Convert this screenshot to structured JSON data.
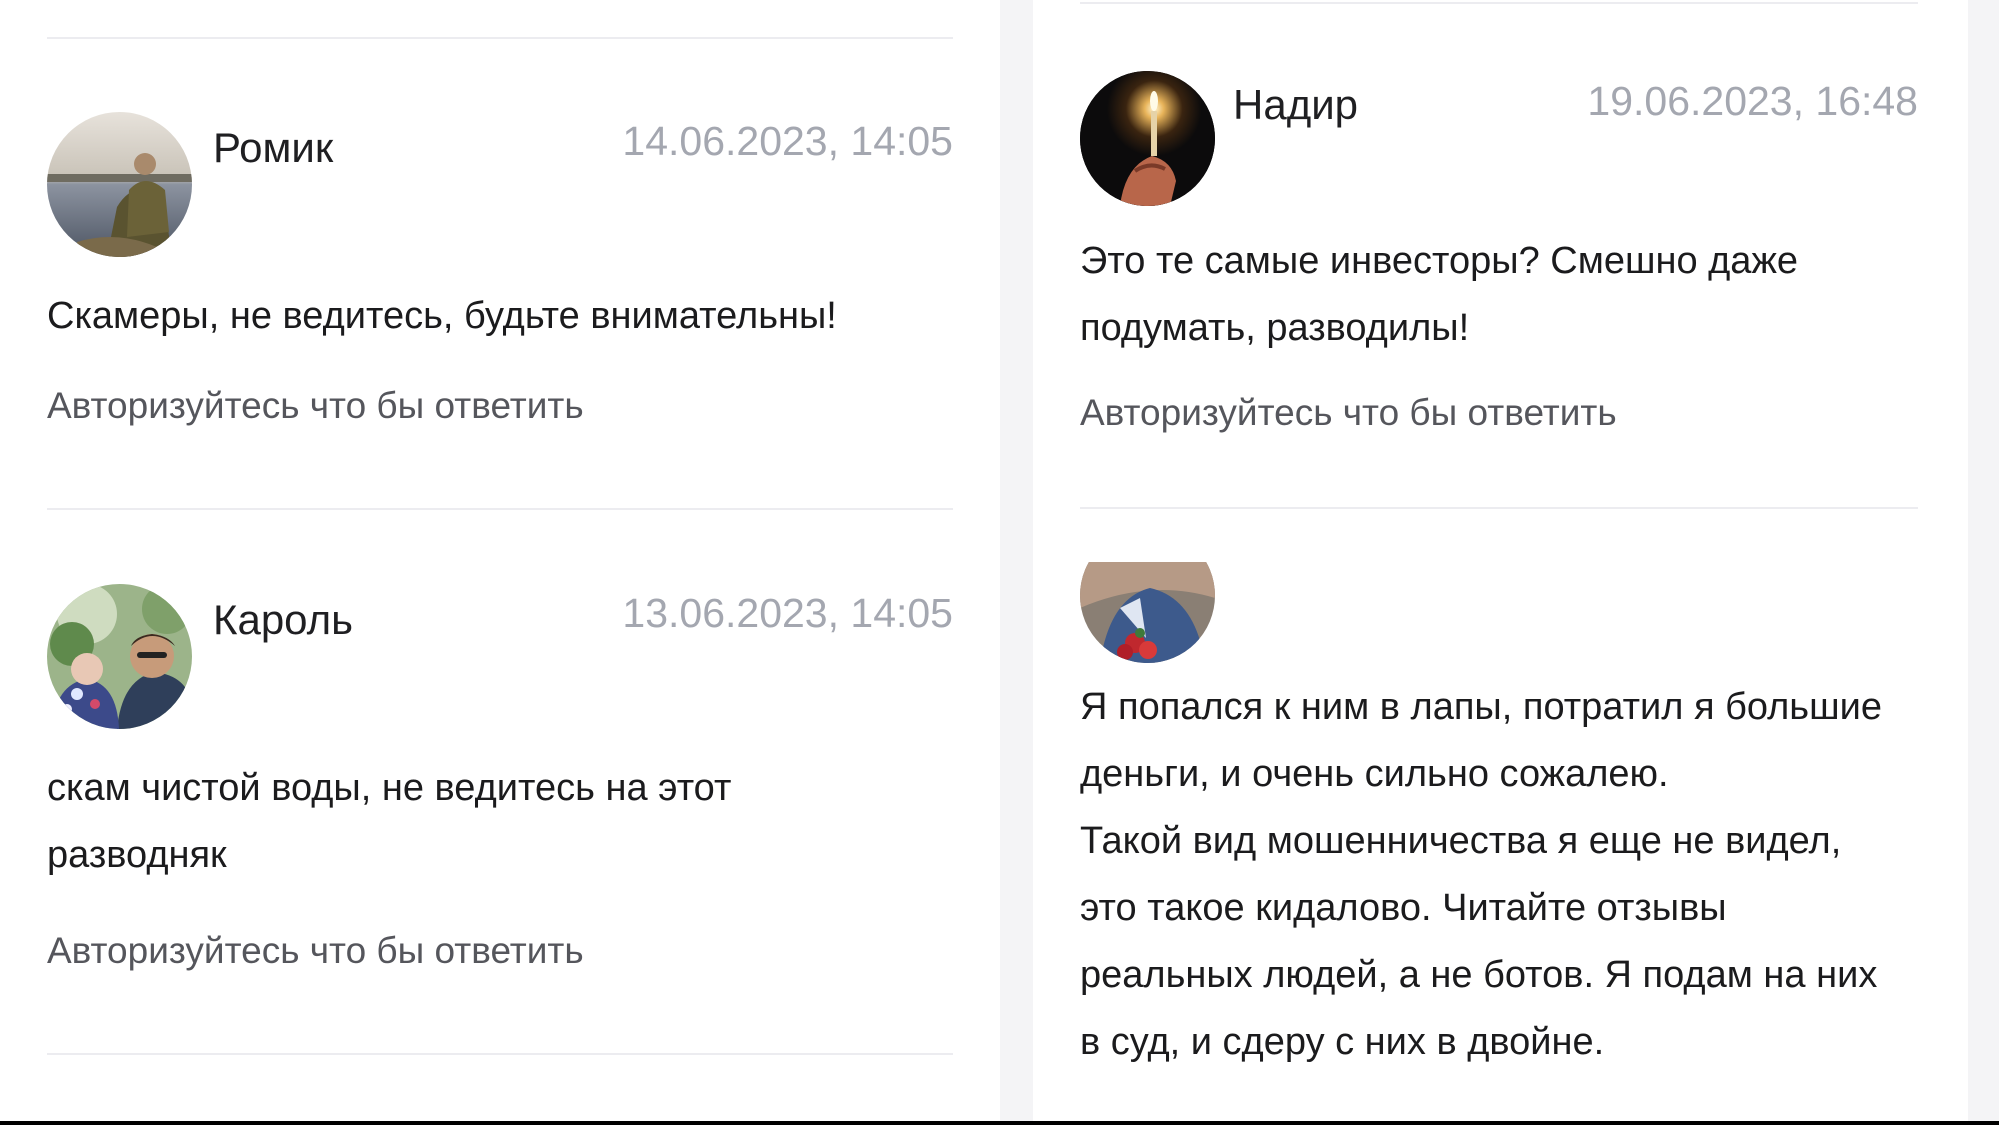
{
  "comments_left": [
    {
      "author": "Ромик",
      "date": "14.06.2023, 14:05",
      "text": "Скамеры, не ведитесь, будьте внимательны!",
      "reply_prompt": "Авторизуйтесь что бы ответить"
    },
    {
      "author": "Кароль",
      "date": "13.06.2023, 14:05",
      "text_lines": [
        "скам чистой воды, не ведитесь на этот",
        "разводняк"
      ],
      "reply_prompt": "Авторизуйтесь что бы ответить"
    }
  ],
  "comments_right": [
    {
      "author": "Надир",
      "date": "19.06.2023, 16:48",
      "text_lines": [
        "Это те самые инвесторы? Смешно даже",
        "подумать, разводилы!"
      ],
      "reply_prompt": "Авторизуйтесь что бы ответить"
    },
    {
      "text_lines": [
        "Я попался к ним в лапы, потратил я большие",
        "деньги, и очень сильно сожалею.",
        "Такой вид мошенничества я еще не видел,",
        "это такое кидалово. Читайте отзывы",
        "реальных людей, а не ботов. Я подам на них",
        "в суд, и сдеру с них в двойне."
      ]
    }
  ],
  "colors": {
    "background": "#ffffff",
    "gutter": "#f4f4f6",
    "divider": "#ececf0",
    "date": "#a4a7b0",
    "reply": "#55565c",
    "text": "#1b1b1d"
  }
}
